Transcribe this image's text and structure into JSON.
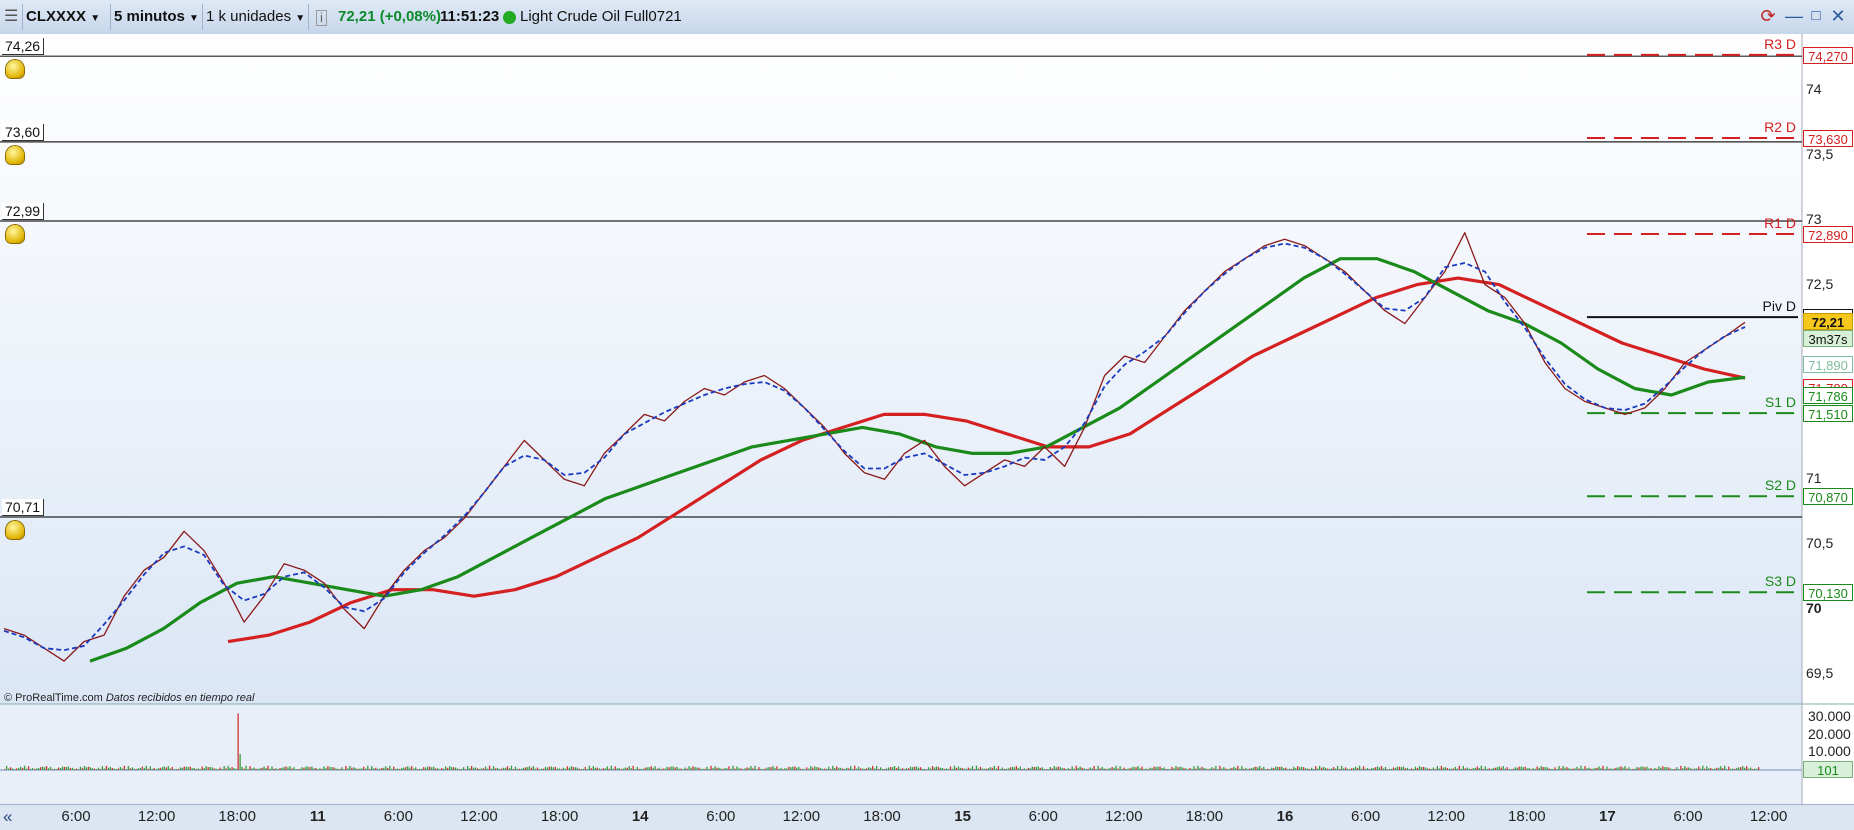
{
  "toolbar": {
    "symbol": "CLXXXX",
    "period": "5 minutos",
    "units": "1 k unidades",
    "price_info": "72,21 (+0,08%)",
    "clock": "11:51:23",
    "instrument": "Light Crude Oil Full0721",
    "status_color": "#22aa22"
  },
  "copyright": {
    "brand": "© ProRealTime.com",
    "note": "Datos recibidos en tiempo real"
  },
  "alerts": [
    {
      "price_label": "74,26",
      "price": 74.26
    },
    {
      "price_label": "73,60",
      "price": 73.6
    },
    {
      "price_label": "72,99",
      "price": 72.99
    },
    {
      "price_label": "70,71",
      "price": 70.71
    }
  ],
  "pivots": [
    {
      "name": "R3 D",
      "value_label": "74,270",
      "value": 74.27,
      "color": "#d42020",
      "style": "dashed"
    },
    {
      "name": "R2 D",
      "value_label": "73,630",
      "value": 73.63,
      "color": "#d42020",
      "style": "dashed"
    },
    {
      "name": "R1 D",
      "value_label": "72,890",
      "value": 72.89,
      "color": "#d42020",
      "style": "dashed"
    },
    {
      "name": "Piv D",
      "value_label": "72,250",
      "value": 72.25,
      "color": "#111111",
      "style": "solid"
    },
    {
      "name": "S1 D",
      "value_label": "71,510",
      "value": 71.51,
      "color": "#1a8a1a",
      "style": "dashed"
    },
    {
      "name": "S2 D",
      "value_label": "70,870",
      "value": 70.87,
      "color": "#1a8a1a",
      "style": "dashed"
    },
    {
      "name": "S3 D",
      "value_label": "70,130",
      "value": 70.13,
      "color": "#1a8a1a",
      "style": "dashed"
    }
  ],
  "price_axis": {
    "ticks": [
      {
        "label": "74",
        "value": 74.0,
        "bold": false
      },
      {
        "label": "73,5",
        "value": 73.5,
        "bold": false
      },
      {
        "label": "73",
        "value": 73.0,
        "bold": false
      },
      {
        "label": "72,5",
        "value": 72.5,
        "bold": false
      },
      {
        "label": "71",
        "value": 71.0,
        "bold": false
      },
      {
        "label": "70,5",
        "value": 70.5,
        "bold": false
      },
      {
        "label": "70",
        "value": 70.0,
        "bold": true
      },
      {
        "label": "69,5",
        "value": 69.5,
        "bold": false
      }
    ],
    "last_price_label": "72,21",
    "countdown": "3m37s",
    "indicator_labels": [
      {
        "label": "71,890",
        "value": 71.89,
        "color": "#7fbfa0"
      },
      {
        "label": "71,780",
        "value": 71.78,
        "color": "#d42020"
      },
      {
        "label": "71,786",
        "value": 71.786,
        "color": "#1a8a1a"
      }
    ]
  },
  "volume_axis": {
    "ticks": [
      {
        "label": "30.000",
        "value": 30000
      },
      {
        "label": "20.000",
        "value": 20000
      },
      {
        "label": "10.000",
        "value": 10000
      }
    ],
    "last_volume": "101"
  },
  "time_axis": {
    "ticks": [
      {
        "label": "6:00",
        "day": false
      },
      {
        "label": "12:00",
        "day": false
      },
      {
        "label": "18:00",
        "day": false
      },
      {
        "label": "11",
        "day": true
      },
      {
        "label": "6:00",
        "day": false
      },
      {
        "label": "12:00",
        "day": false
      },
      {
        "label": "18:00",
        "day": false
      },
      {
        "label": "14",
        "day": true
      },
      {
        "label": "6:00",
        "day": false
      },
      {
        "label": "12:00",
        "day": false
      },
      {
        "label": "18:00",
        "day": false
      },
      {
        "label": "15",
        "day": true
      },
      {
        "label": "6:00",
        "day": false
      },
      {
        "label": "12:00",
        "day": false
      },
      {
        "label": "18:00",
        "day": false
      },
      {
        "label": "16",
        "day": true
      },
      {
        "label": "6:00",
        "day": false
      },
      {
        "label": "12:00",
        "day": false
      },
      {
        "label": "18:00",
        "day": false
      },
      {
        "label": "17",
        "day": true
      },
      {
        "label": "6:00",
        "day": false
      },
      {
        "label": "12:00",
        "day": false
      }
    ]
  },
  "colors": {
    "price_line": "#8b1a1a",
    "fast_ma": "#1a8a1a",
    "slow_ma": "#d42020",
    "dashed_ma": "#1a3ac0",
    "background_top": "#ffffff",
    "background_bottom": "#dbe6f5"
  },
  "chart_data": {
    "type": "line",
    "ylim": [
      69.3,
      74.4
    ],
    "series": [
      {
        "role": "price",
        "values": [
          69.85,
          69.8,
          69.7,
          69.6,
          69.75,
          69.8,
          70.1,
          70.3,
          70.4,
          70.6,
          70.45,
          70.2,
          69.9,
          70.1,
          70.35,
          70.3,
          70.2,
          70.0,
          69.85,
          70.1,
          70.3,
          70.45,
          70.55,
          70.7,
          70.9,
          71.1,
          71.3,
          71.15,
          71.0,
          70.95,
          71.2,
          71.35,
          71.5,
          71.45,
          71.6,
          71.7,
          71.65,
          71.75,
          71.8,
          71.7,
          71.55,
          71.4,
          71.2,
          71.05,
          71.0,
          71.2,
          71.3,
          71.1,
          70.95,
          71.05,
          71.15,
          71.1,
          71.25,
          71.1,
          71.4,
          71.8,
          71.95,
          71.9,
          72.1,
          72.3,
          72.45,
          72.6,
          72.7,
          72.8,
          72.85,
          72.8,
          72.7,
          72.6,
          72.45,
          72.3,
          72.2,
          72.4,
          72.6,
          72.9,
          72.5,
          72.4,
          72.2,
          71.9,
          71.7,
          71.6,
          71.55,
          71.5,
          71.55,
          71.7,
          71.9,
          72.0,
          72.1,
          72.21
        ]
      },
      {
        "role": "fast_ma",
        "values": [
          69.6,
          69.7,
          69.85,
          70.05,
          70.2,
          70.25,
          70.2,
          70.15,
          70.1,
          70.15,
          70.25,
          70.4,
          70.55,
          70.7,
          70.85,
          70.95,
          71.05,
          71.15,
          71.25,
          71.3,
          71.35,
          71.4,
          71.35,
          71.25,
          71.2,
          71.2,
          71.25,
          71.4,
          71.55,
          71.75,
          71.95,
          72.15,
          72.35,
          72.55,
          72.7,
          72.7,
          72.6,
          72.45,
          72.3,
          72.2,
          72.05,
          71.85,
          71.7,
          71.65,
          71.75,
          71.786
        ]
      },
      {
        "role": "slow_ma",
        "values": [
          69.75,
          69.8,
          69.9,
          70.05,
          70.15,
          70.15,
          70.1,
          70.15,
          70.25,
          70.4,
          70.55,
          70.75,
          70.95,
          71.15,
          71.3,
          71.4,
          71.5,
          71.5,
          71.45,
          71.35,
          71.25,
          71.25,
          71.35,
          71.55,
          71.75,
          71.95,
          72.1,
          72.25,
          72.4,
          72.5,
          72.55,
          72.5,
          72.35,
          72.2,
          72.05,
          71.95,
          71.85,
          71.78
        ]
      }
    ],
    "volume": {
      "spike_value": 32000,
      "typical_max": 4000
    }
  }
}
